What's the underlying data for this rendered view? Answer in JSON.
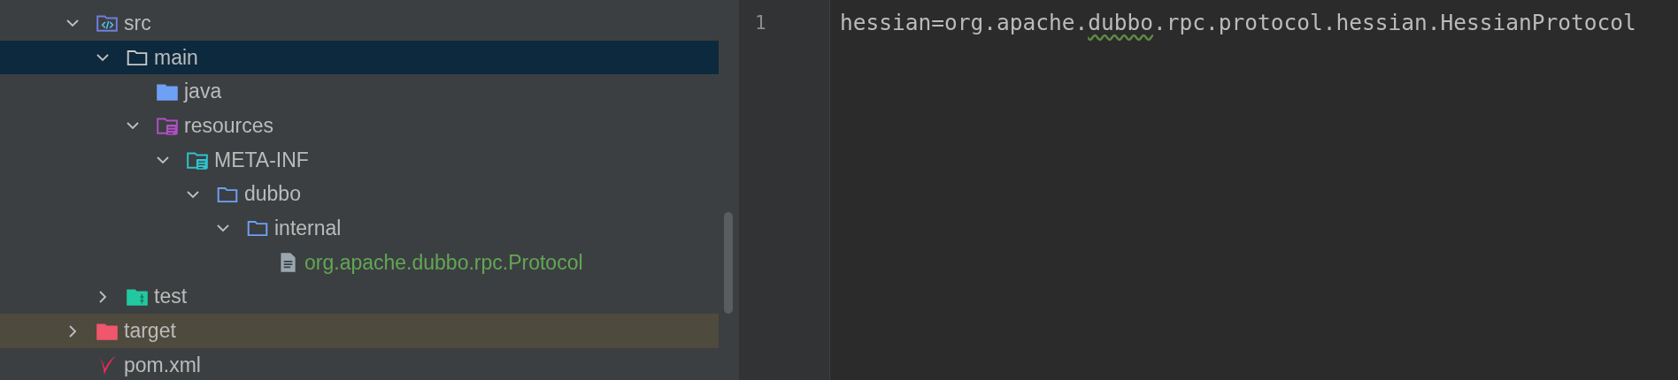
{
  "project_tree": [
    {
      "name": "src",
      "kind": "source",
      "expanded": true,
      "selected": false,
      "highlighted": false,
      "added": false,
      "children": [
        {
          "name": "main",
          "kind": "folder",
          "expanded": true,
          "selected": true,
          "highlighted": false,
          "added": false,
          "children": [
            {
              "name": "java",
              "kind": "java",
              "selected": false,
              "highlighted": false,
              "added": false
            },
            {
              "name": "resources",
              "kind": "resources",
              "expanded": true,
              "selected": false,
              "highlighted": false,
              "added": false,
              "children": [
                {
                  "name": "META-INF",
                  "kind": "meta",
                  "expanded": true,
                  "selected": false,
                  "highlighted": false,
                  "added": false,
                  "children": [
                    {
                      "name": "dubbo",
                      "kind": "package",
                      "expanded": true,
                      "selected": false,
                      "highlighted": false,
                      "added": false,
                      "children": [
                        {
                          "name": "internal",
                          "kind": "package",
                          "expanded": true,
                          "selected": false,
                          "highlighted": false,
                          "added": false,
                          "children": [
                            {
                              "name": "org.apache.dubbo.rpc.Protocol",
                              "kind": "file",
                              "selected": false,
                              "highlighted": false,
                              "added": true
                            }
                          ]
                        }
                      ]
                    }
                  ]
                }
              ]
            }
          ]
        },
        {
          "name": "test",
          "kind": "test",
          "expanded": false,
          "selected": false,
          "highlighted": false,
          "added": false
        }
      ]
    },
    {
      "name": "target",
      "kind": "excluded",
      "expanded": false,
      "selected": false,
      "highlighted": true,
      "added": false
    },
    {
      "name": "pom.xml",
      "kind": "maven",
      "selected": false,
      "highlighted": false,
      "added": false
    }
  ],
  "editor": {
    "lines": [
      {
        "number": "1",
        "segments": [
          {
            "text": "hessian=org.apache.",
            "warning": false
          },
          {
            "text": "dubbo",
            "warning": true
          },
          {
            "text": ".rpc.protocol.hessian.HessianProtocol",
            "warning": false
          }
        ]
      }
    ]
  }
}
